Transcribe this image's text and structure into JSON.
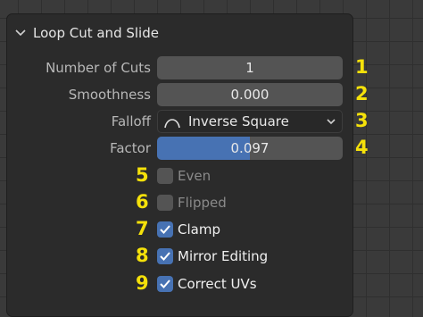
{
  "panel": {
    "title": "Loop Cut and Slide",
    "number_of_cuts": {
      "label": "Number of Cuts",
      "value": "1"
    },
    "smoothness": {
      "label": "Smoothness",
      "value": "0.000"
    },
    "falloff": {
      "label": "Falloff",
      "value": "Inverse Square",
      "icon": "inverse-square-curve-icon"
    },
    "factor": {
      "label": "Factor",
      "value": "0.097",
      "fill_fraction": 0.5
    },
    "checkboxes": [
      {
        "label": "Even",
        "checked": false
      },
      {
        "label": "Flipped",
        "checked": false
      },
      {
        "label": "Clamp",
        "checked": true
      },
      {
        "label": "Mirror Editing",
        "checked": true
      },
      {
        "label": "Correct UVs",
        "checked": true
      }
    ]
  },
  "annotations": [
    "1",
    "2",
    "3",
    "4",
    "5",
    "6",
    "7",
    "8",
    "9"
  ],
  "colors": {
    "accent": "#4772b3",
    "annotation": "#f5e10a",
    "panel": "#2b2b2b"
  }
}
